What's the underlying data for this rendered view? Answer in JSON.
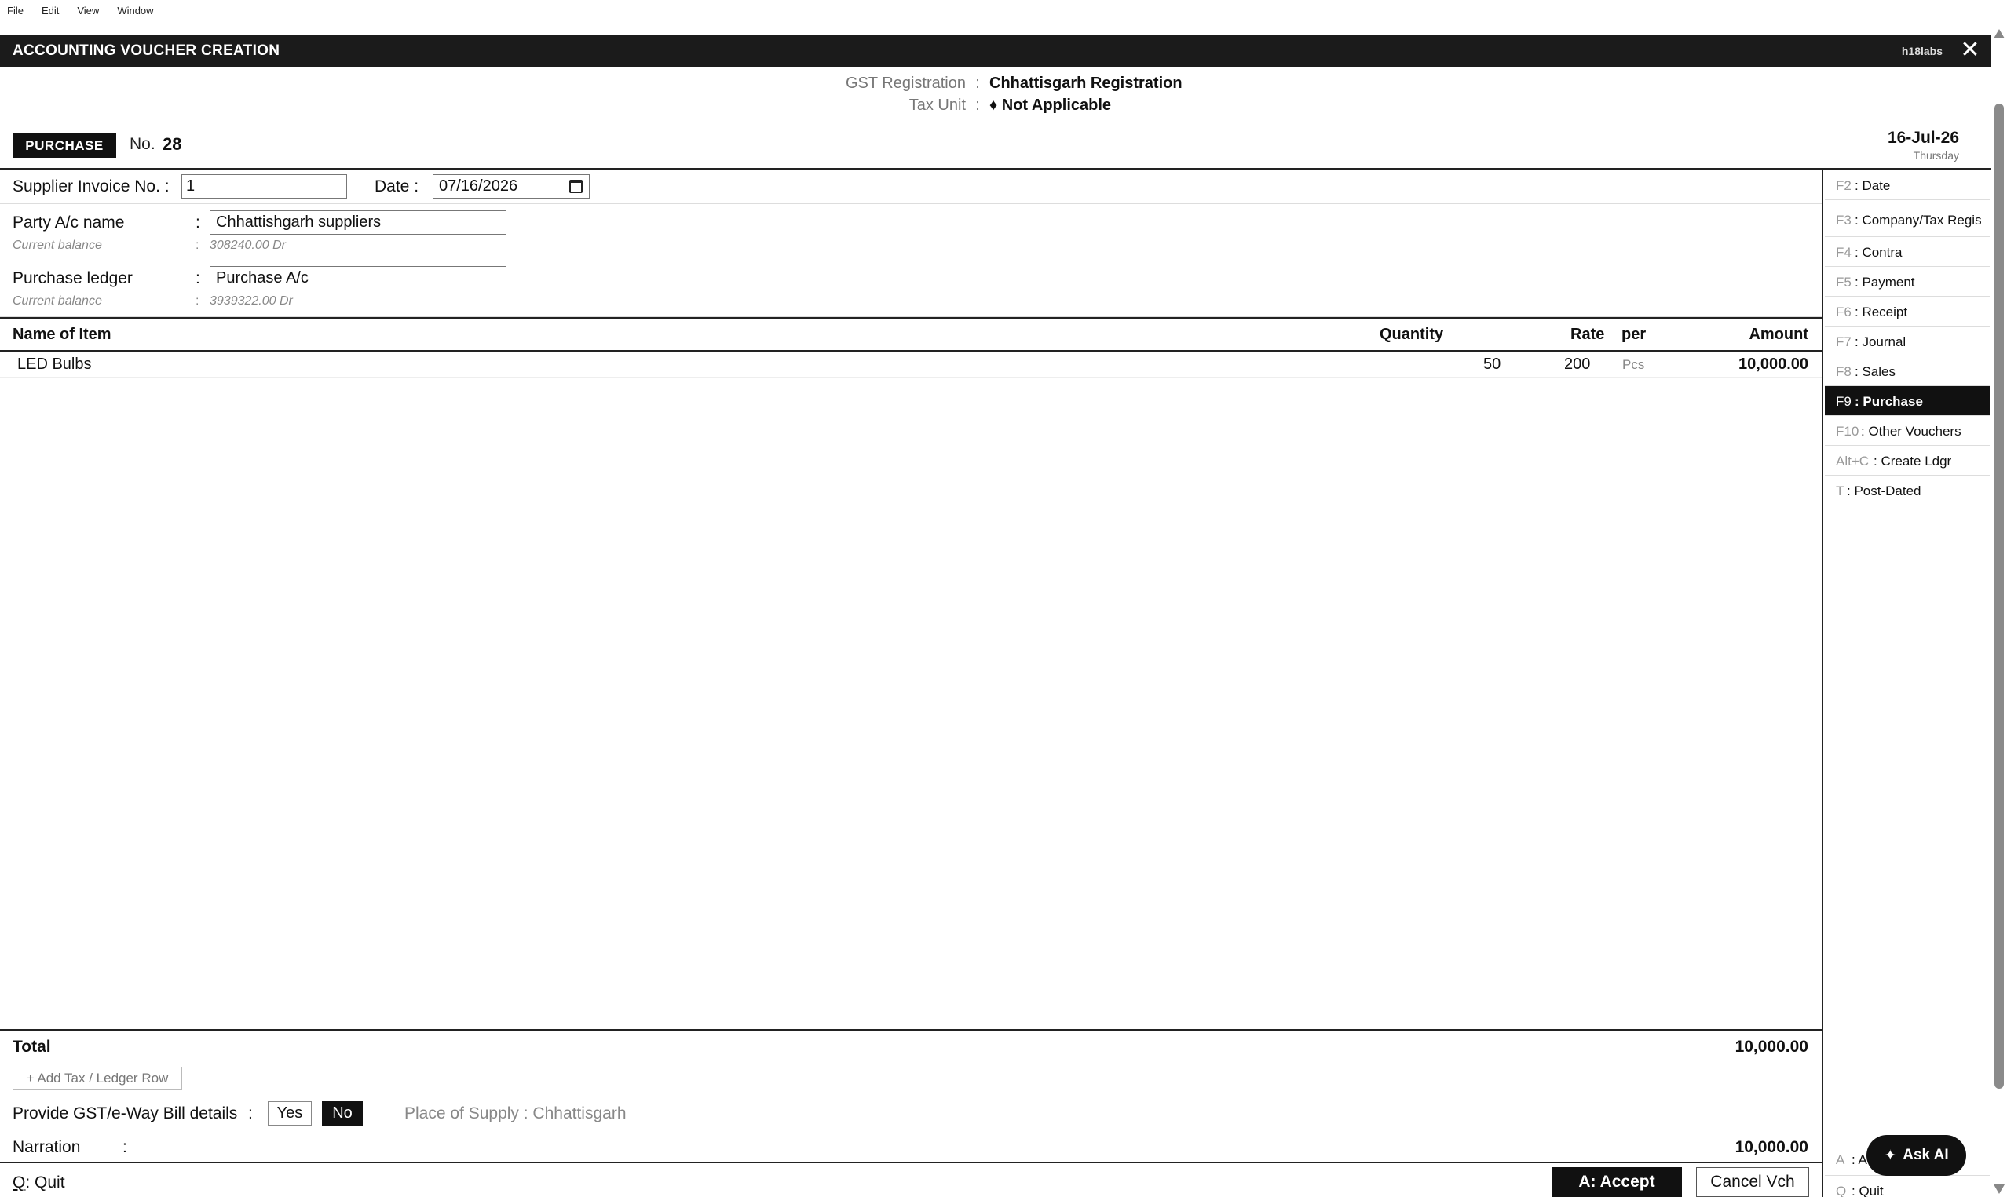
{
  "menu": [
    "File",
    "Edit",
    "View",
    "Window"
  ],
  "window": {
    "title": "ACCOUNTING VOUCHER CREATION",
    "brand": "h18labs",
    "close_glyph": "✕"
  },
  "gst": {
    "registration_label": "GST Registration",
    "registration_value": "Chhattisgarh Registration",
    "tax_unit_label": "Tax Unit",
    "tax_unit_value": "♦ Not Applicable",
    "sep": ":"
  },
  "voucher": {
    "type": "PURCHASE",
    "no_label": "No.",
    "no_value": "28",
    "date": "16-Jul-26",
    "day": "Thursday"
  },
  "invoice": {
    "supplier_label": "Supplier Invoice No. :",
    "supplier_value": "1",
    "date_label": "Date :",
    "date_value": "07/16/2026"
  },
  "party": {
    "label": "Party A/c name",
    "value": "Chhattishgarh suppliers",
    "balance_label": "Current balance",
    "balance_value": "308240.00 Dr"
  },
  "purchase_ledger": {
    "label": "Purchase ledger",
    "value": "Purchase A/c",
    "balance_label": "Current balance",
    "balance_value": "3939322.00 Dr"
  },
  "items": {
    "headers": {
      "name": "Name of Item",
      "quantity": "Quantity",
      "rate": "Rate",
      "per": "per",
      "amount": "Amount"
    },
    "rows": [
      {
        "name": "LED Bulbs",
        "quantity": "50",
        "rate": "200",
        "per": "Pcs",
        "amount": "10,000.00"
      }
    ]
  },
  "total": {
    "label": "Total",
    "value": "10,000.00"
  },
  "add_tax_label": "+ Add Tax / Ledger Row",
  "gst_details": {
    "label": "Provide GST/e-Way Bill details",
    "yes": "Yes",
    "no": "No",
    "place_of_supply": "Place of Supply : Chhattisgarh"
  },
  "narration": {
    "label": "Narration",
    "colon": ":",
    "value": "10,000.00"
  },
  "footer": {
    "quit_key": "Q",
    "quit_rest": ": Quit",
    "accept": "A: Accept",
    "cancel": "Cancel Vch"
  },
  "sidebar": [
    {
      "key": "F2",
      "label": ": Date"
    },
    {
      "key": "F3",
      "label": ": Company/Tax Regis"
    },
    {
      "key": "F4",
      "label": ": Contra"
    },
    {
      "key": "F5",
      "label": ": Payment"
    },
    {
      "key": "F6",
      "label": ": Receipt"
    },
    {
      "key": "F7",
      "label": ": Journal"
    },
    {
      "key": "F8",
      "label": ": Sales"
    },
    {
      "key": "F9",
      "label": ": Purchase",
      "active": true
    },
    {
      "key": "F10",
      "label": ": Other Vouchers"
    },
    {
      "key": "Alt+C",
      "label": ": Create Ldgr"
    },
    {
      "key": "T",
      "label": ": Post-Dated"
    }
  ],
  "sidebar_bottom": [
    {
      "key": "A",
      "label": ": A"
    },
    {
      "key": "Q",
      "label": ": Quit"
    }
  ],
  "ask_ai": {
    "icon": "✦",
    "label": "Ask AI"
  },
  "colors": {
    "dark": "#111111",
    "muted": "#888888",
    "border": "#dddddd"
  }
}
